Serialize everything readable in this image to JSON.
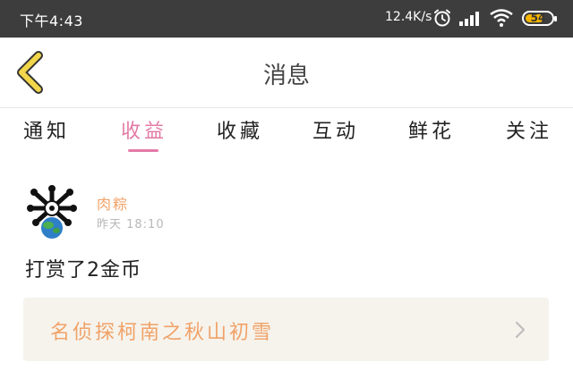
{
  "status_bar": {
    "time": "下午4:43",
    "network_speed": "12.4K/s",
    "battery_level": "54",
    "icons": [
      "alarm-icon",
      "signal-icon",
      "wifi-icon",
      "battery-icon"
    ]
  },
  "header": {
    "title": "消息",
    "back_icon": "back-chevron-icon"
  },
  "tabs": [
    {
      "label": "通知",
      "active": false
    },
    {
      "label": "收益",
      "active": true
    },
    {
      "label": "收藏",
      "active": false
    },
    {
      "label": "互动",
      "active": false
    },
    {
      "label": "鲜花",
      "active": false
    },
    {
      "label": "关注",
      "active": false
    }
  ],
  "message": {
    "username": "肉粽",
    "time": "昨天 18:10",
    "content": "打赏了2金币",
    "book": {
      "title": "名侦探柯南之秋山初雪"
    }
  },
  "colors": {
    "accent_pink": "#e37aa6",
    "accent_orange": "#f0a268",
    "back_yellow": "#f2d64b",
    "status_bar_bg": "#3d3d3d",
    "card_bg": "#f6f3ec"
  }
}
